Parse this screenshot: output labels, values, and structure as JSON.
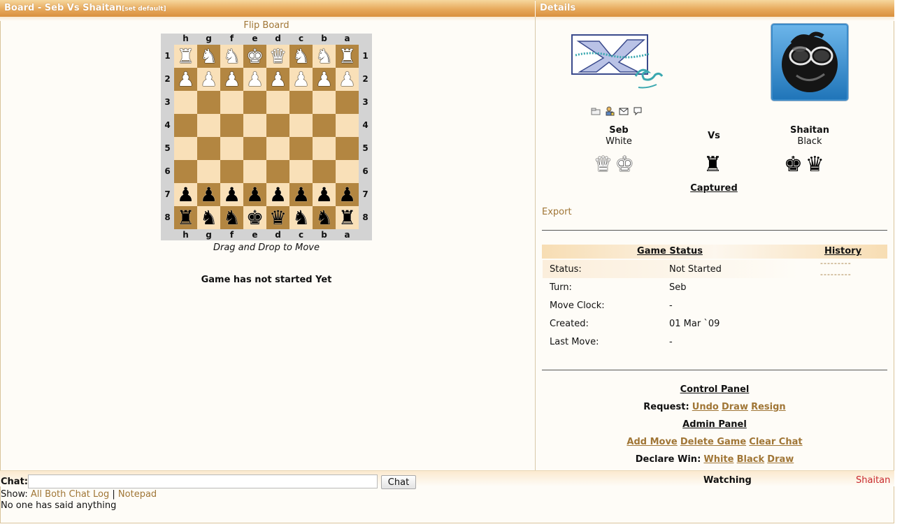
{
  "board_panel": {
    "title": "Board - Seb Vs Shaitan",
    "set_default": "[set default]",
    "flip_label": "Flip Board",
    "files": [
      "h",
      "g",
      "f",
      "e",
      "d",
      "c",
      "b",
      "a"
    ],
    "ranks": [
      "1",
      "2",
      "3",
      "4",
      "5",
      "6",
      "7",
      "8"
    ],
    "rows": [
      [
        "wR",
        "wN",
        "wN",
        "wK",
        "wQ",
        "wN",
        "wN",
        "wR"
      ],
      [
        "wP",
        "wP",
        "wP",
        "wP",
        "wP",
        "wP",
        "wP",
        "wP"
      ],
      [
        "",
        "",
        "",
        "",
        "",
        "",
        "",
        ""
      ],
      [
        "",
        "",
        "",
        "",
        "",
        "",
        "",
        ""
      ],
      [
        "",
        "",
        "",
        "",
        "",
        "",
        "",
        ""
      ],
      [
        "",
        "",
        "",
        "",
        "",
        "",
        "",
        ""
      ],
      [
        "bP",
        "bP",
        "bP",
        "bP",
        "bP",
        "bP",
        "bP",
        "bP"
      ],
      [
        "bR",
        "bN",
        "bN",
        "bK",
        "bQ",
        "bN",
        "bN",
        "bR"
      ]
    ],
    "drag_hint": "Drag and Drop to Move",
    "game_state": "Game has not started Yet"
  },
  "details": {
    "title": "Details",
    "white_player": {
      "name": "Seb",
      "color": "White",
      "pieces": [
        "wQ",
        "wK"
      ]
    },
    "vs": "Vs",
    "captured_piece": "bR",
    "black_player": {
      "name": "Shaitan",
      "color": "Black",
      "pieces": [
        "bK",
        "bQ"
      ]
    },
    "captured_label": "Captured",
    "export_label": "Export",
    "mini_icons": [
      "tag-icon",
      "user-icon",
      "mail-icon",
      "chat-bubble-icon"
    ],
    "game_status": {
      "title": "Game Status",
      "rows": [
        {
          "label": "Status:",
          "value": "Not Started"
        },
        {
          "label": "Turn:",
          "value": "Seb"
        },
        {
          "label": "Move Clock:",
          "value": "-"
        },
        {
          "label": "Created:",
          "value": "01 Mar `09"
        },
        {
          "label": "Last Move:",
          "value": "-"
        }
      ]
    },
    "history": {
      "title": "History",
      "dashes": [
        "---------",
        "---------"
      ]
    },
    "control_panel": {
      "title": "Control Panel",
      "request_label": "Request:",
      "request_links": [
        "Undo",
        "Draw",
        "Resign"
      ]
    },
    "admin_panel": {
      "title": "Admin Panel",
      "admin_links": [
        "Add Move",
        "Delete Game",
        "Clear Chat"
      ],
      "declare_label": "Declare Win:",
      "declare_links": [
        "White",
        "Black",
        "Draw"
      ]
    }
  },
  "chat": {
    "label": "Chat:",
    "input_value": "",
    "send_label": "Chat",
    "show_label": "Show:",
    "show_links": [
      "All",
      "Both",
      "Chat Log"
    ],
    "separator": "|",
    "notepad_label": "Notepad",
    "empty_message": "No one has said anything",
    "watching_label": "Watching",
    "watchers": [
      "Shaitan"
    ]
  },
  "colors": {
    "light_square": "#f9e0b8",
    "dark_square": "#b38641",
    "link": "#a07636",
    "watcher": "#c8282d",
    "header": "#e7a95c"
  }
}
